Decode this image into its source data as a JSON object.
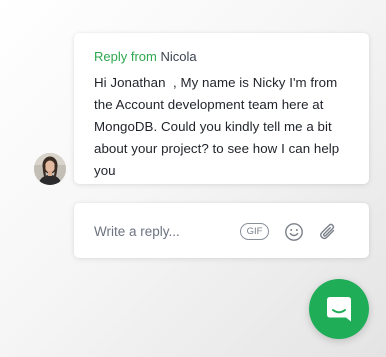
{
  "message": {
    "reply_prefix": "Reply from",
    "sender_name": "Nicola",
    "body": "Hi Jonathan  , My name is Nicky I'm from\nthe Account development team here at\nMongoDB. Could you kindly tell me a bit\nabout your project? to see how I can help\nyou"
  },
  "composer": {
    "placeholder": "Write a reply...",
    "value": "",
    "gif_label": "GIF"
  },
  "icons": {
    "avatar": "sender-avatar-photo",
    "emoji": "smiley-face-icon",
    "attach": "paperclip-icon",
    "launcher": "chat-bubble-icon"
  },
  "colors": {
    "accent_green": "#1fae57",
    "reply_prefix_green": "#2ea84f"
  }
}
